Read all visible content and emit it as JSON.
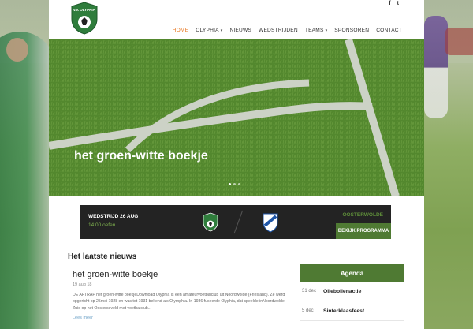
{
  "social": {
    "facebook": "f",
    "twitter": "t"
  },
  "nav": {
    "items": [
      {
        "label": "HOME",
        "active": true,
        "caret": false
      },
      {
        "label": "OLYPHIA",
        "active": false,
        "caret": true
      },
      {
        "label": "NIEUWS",
        "active": false,
        "caret": false
      },
      {
        "label": "WEDSTRIJDEN",
        "active": false,
        "caret": false
      },
      {
        "label": "TEAMS",
        "active": false,
        "caret": true
      },
      {
        "label": "SPONSOREN",
        "active": false,
        "caret": false
      },
      {
        "label": "CONTACT",
        "active": false,
        "caret": false
      }
    ]
  },
  "logo": {
    "text": "v.v. OLYPHIA"
  },
  "hero": {
    "title": "het groen-witte boekje"
  },
  "match": {
    "date": "WEDSTRIJD 26 AUG",
    "time": "14:00 oefen",
    "venue": "OOSTERWOLDE",
    "button": "BEKIJK PROGRAMMA"
  },
  "news": {
    "heading": "Het laatste nieuws",
    "title": "het groen-witte boekje",
    "date": "19 aug 18",
    "body": "DE AFTRAP het groen-witte boekjeDownload Olyphia is een amateurvoetbalclub uit Noordwolde (Friesland). Ze werd opgericht op 25mei 1928 en was tot 1931 bekend als Olymphia. In 1936 fuseerde Olyphia, dat speelde inNoordwolde-Zuid op het Oosterseveld met voetbalclub...",
    "more": "Lees meer"
  },
  "agenda": {
    "heading": "Agenda",
    "items": [
      {
        "date": "31 dec",
        "label": "Oliebollenactie"
      },
      {
        "date": "5 dec",
        "label": "Sinterklaasfeest"
      }
    ]
  },
  "colors": {
    "accent": "#e8761f",
    "brand_green": "#4f7a33",
    "dark": "#232323"
  }
}
